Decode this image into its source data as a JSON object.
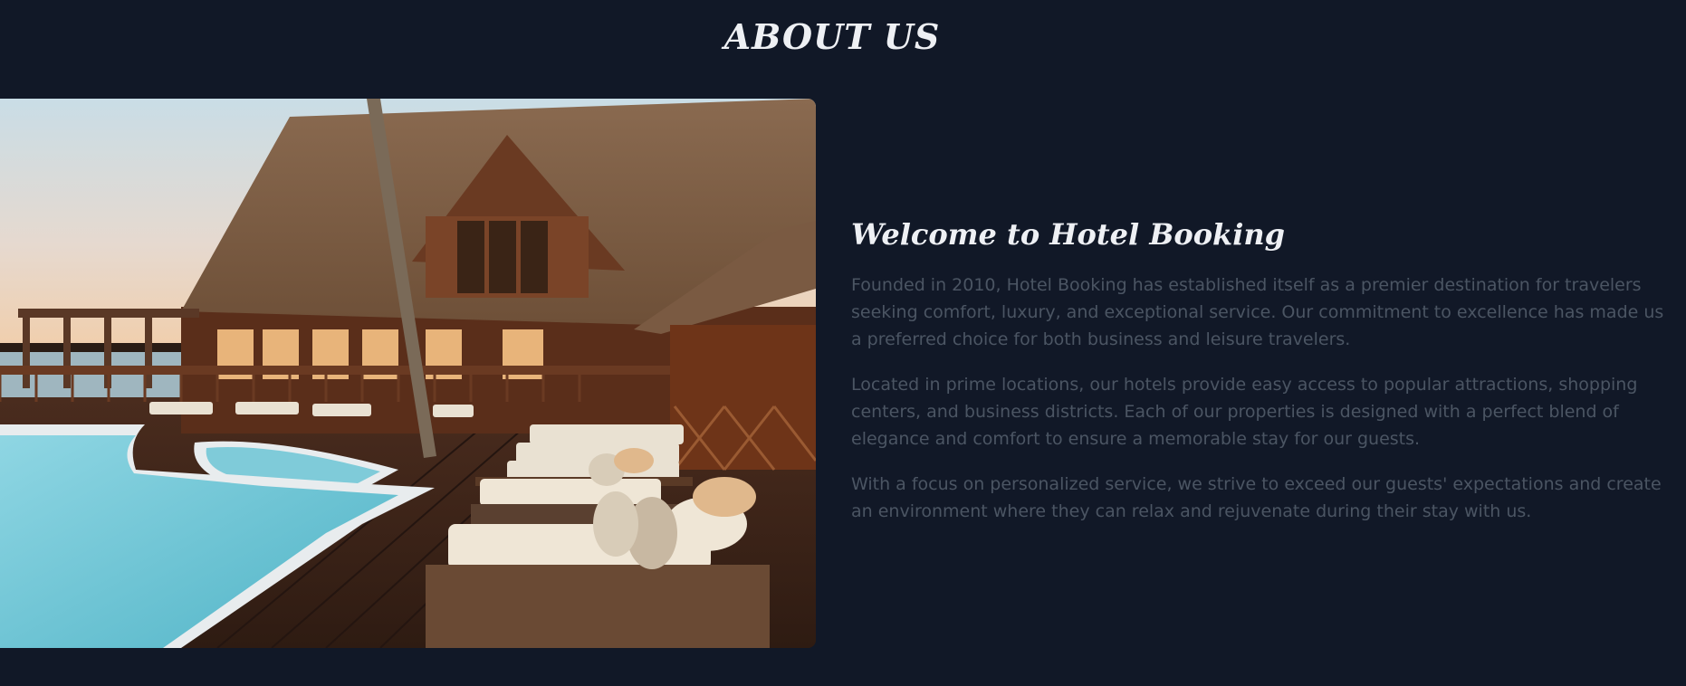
{
  "section": {
    "title": "ABOUT US"
  },
  "about": {
    "heading": "Welcome to Hotel Booking",
    "paragraphs": [
      "Founded in 2010, Hotel Booking has established itself as a premier destination for travelers seeking comfort, luxury, and exceptional service. Our commitment to excellence has made us a preferred choice for both business and leisure travelers.",
      "Located in prime locations, our hotels provide easy access to popular attractions, shopping centers, and business districts. Each of our properties is designed with a perfect blend of elegance and comfort to ensure a memorable stay for our guests.",
      "With a focus on personalized service, we strive to exceed our guests' expectations and create an environment where they can relax and rejuvenate during their stay with us."
    ]
  },
  "colors": {
    "background": "#111827",
    "heading": "#eef0f4",
    "body_text": "#4b5563"
  }
}
